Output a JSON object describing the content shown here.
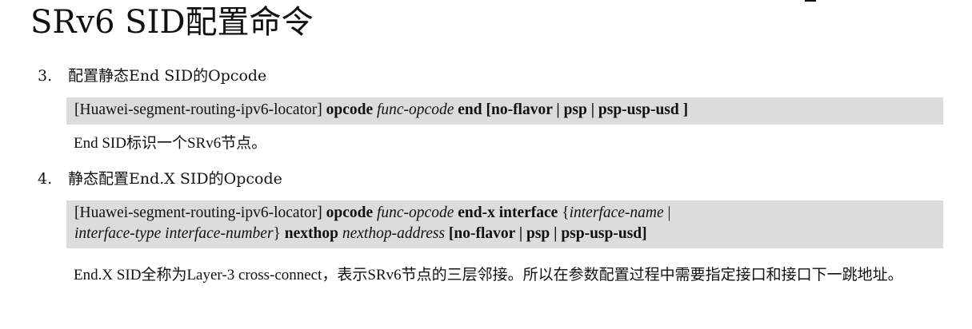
{
  "page_title": "SRv6 SID配置命令",
  "steps": [
    {
      "number": "3.",
      "heading": "配置静态End SID的Opcode",
      "command": {
        "view": "[Huawei-segment-routing-ipv6-locator]",
        "kw_opcode": "opcode",
        "arg_opcode": "func-opcode",
        "kw_end": "end",
        "options": "[no-flavor | psp | psp-usp-usd ]"
      },
      "description": "End SID标识一个SRv6节点。"
    },
    {
      "number": "4.",
      "heading": "静态配置End.X SID的Opcode",
      "command": {
        "view": "[Huawei-segment-routing-ipv6-locator]",
        "kw_opcode": "opcode",
        "arg_opcode": "func-opcode",
        "kw_endx": "end-x interface",
        "brace_open": "{",
        "arg_if_name": "interface-name",
        "sep": "|",
        "arg_if_type": "interface-type",
        "arg_if_number": "interface-number",
        "brace_close": "}",
        "kw_nexthop": "nexthop",
        "arg_nexthop": "nexthop-address",
        "options": "[no-flavor | psp | psp-usp-usd]"
      },
      "description": "End.X SID全称为Layer-3 cross-connect，表示SRv6节点的三层邻接。所以在参数配置过程中需要指定接口和接口下一跳地址。"
    }
  ]
}
